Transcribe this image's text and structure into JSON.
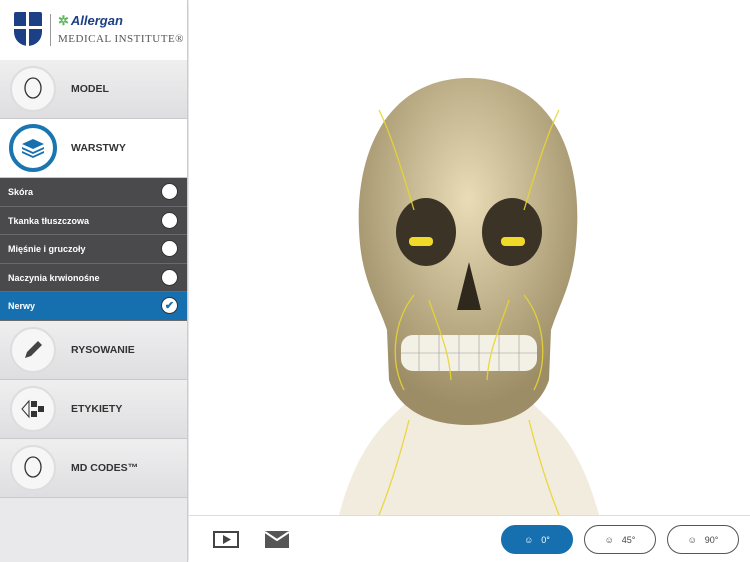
{
  "logo": {
    "brand": "Allergan",
    "institute": "MEDICAL INSTITUTE®"
  },
  "nav": {
    "model": "MODEL",
    "warstwy": "WARSTWY",
    "rysowanie": "RYSOWANIE",
    "etykiety": "ETYKIETY",
    "mdcodes": "MD CODES™"
  },
  "layers": [
    {
      "label": "Skóra",
      "checked": false
    },
    {
      "label": "Tkanka tłuszczowa",
      "checked": false
    },
    {
      "label": "Mięśnie i gruczoły",
      "checked": false
    },
    {
      "label": "Naczynia krwionośne",
      "checked": false
    },
    {
      "label": "Nerwy",
      "checked": true
    }
  ],
  "views": {
    "front": "0°",
    "oblique": "45°",
    "side": "90°"
  },
  "colors": {
    "accent": "#1670b0",
    "nerve": "#e8d530"
  }
}
